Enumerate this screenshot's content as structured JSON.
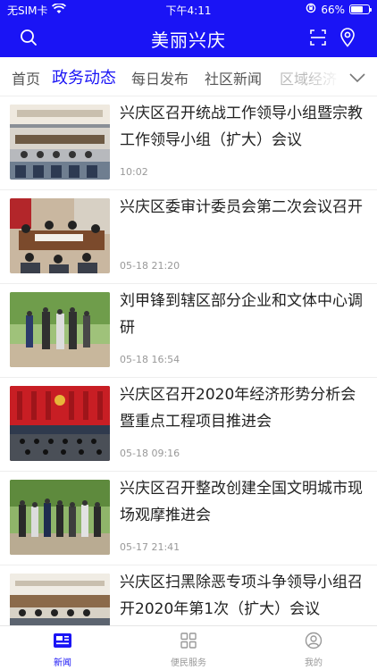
{
  "status": {
    "carrier": "无SIM卡",
    "time": "下午4:11",
    "battery": "66%",
    "battery_level": 0.66
  },
  "header": {
    "title": "美丽兴庆",
    "icons": [
      "search-icon",
      "scan-icon",
      "location-pin-icon"
    ]
  },
  "tabs": [
    {
      "label": "首页"
    },
    {
      "label": "政务动态",
      "active": true
    },
    {
      "label": "每日发布"
    },
    {
      "label": "社区新闻"
    },
    {
      "label": "区域经济"
    }
  ],
  "news": [
    {
      "title": "兴庆区召开统战工作领导小组暨宗教工作领导小组（扩大）会议",
      "time": "10:02"
    },
    {
      "title": "兴庆区委审计委员会第二次会议召开",
      "time": "05-18 21:20"
    },
    {
      "title": "刘甲锋到辖区部分企业和文体中心调研",
      "time": "05-18 16:54"
    },
    {
      "title": "兴庆区召开2020年经济形势分析会暨重点工程项目推进会",
      "time": "05-18 09:16"
    },
    {
      "title": "兴庆区召开整改创建全国文明城市现场观摩推进会",
      "time": "05-17 21:41"
    },
    {
      "title": "兴庆区扫黑除恶专项斗争领导小组召开2020年第1次（扩大）会议",
      "time": ""
    }
  ],
  "tabbar": [
    {
      "label": "新闻",
      "icon": "news-icon",
      "active": true
    },
    {
      "label": "便民服务",
      "icon": "grid-icon"
    },
    {
      "label": "我的",
      "icon": "profile-icon"
    }
  ],
  "colors": {
    "brand": "#1a14f5",
    "meta": "#999999"
  }
}
